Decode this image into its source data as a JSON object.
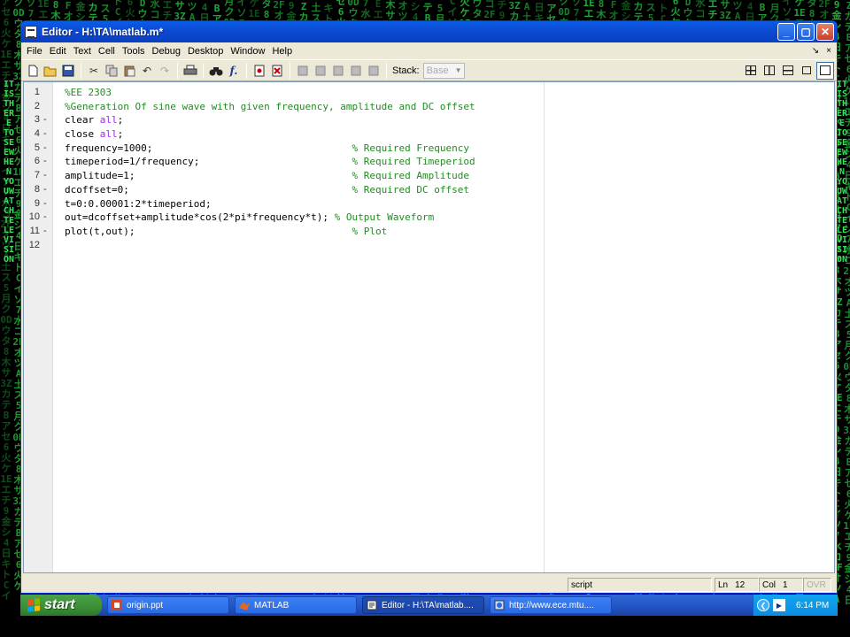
{
  "window": {
    "title": "Editor - H:\\TA\\matlab.m*",
    "controls": {
      "minimize": "_",
      "maximize": "▢",
      "close": "✕"
    }
  },
  "menu": {
    "items": [
      "File",
      "Edit",
      "Text",
      "Cell",
      "Tools",
      "Debug",
      "Desktop",
      "Window",
      "Help"
    ],
    "right_icons": [
      "↘",
      "×"
    ]
  },
  "toolbar": {
    "stack_label": "Stack:",
    "stack_value": "Base"
  },
  "editor": {
    "lines": [
      {
        "n": "1",
        "bp": "",
        "code": "",
        "comment": "%EE 2303"
      },
      {
        "n": "2",
        "bp": "",
        "code": "",
        "comment": "%Generation Of sine wave with given frequency, amplitude and DC offset"
      },
      {
        "n": "3",
        "bp": "-",
        "code": "clear ",
        "kw": "all",
        "tail": ";"
      },
      {
        "n": "4",
        "bp": "-",
        "code": "close ",
        "kw": "all",
        "tail": ";"
      },
      {
        "n": "5",
        "bp": "-",
        "code": "frequency=1000;                                  ",
        "comment": "% Required Frequency"
      },
      {
        "n": "6",
        "bp": "-",
        "code": "timeperiod=1/frequency;                          ",
        "comment": "% Required Timeperiod"
      },
      {
        "n": "7",
        "bp": "-",
        "code": "amplitude=1;                                     ",
        "comment": "% Required Amplitude"
      },
      {
        "n": "8",
        "bp": "-",
        "code": "dcoffset=0;                                      ",
        "comment": "% Required DC offset"
      },
      {
        "n": "9",
        "bp": "-",
        "code": "t=0:0.00001:2*timeperiod;",
        "comment": ""
      },
      {
        "n": "10",
        "bp": "-",
        "code": "out=dcoffset+amplitude*cos(2*pi*frequency*t); ",
        "comment": "% Output Waveform"
      },
      {
        "n": "11",
        "bp": "-",
        "code": "plot(t,out);                                     ",
        "comment": "% Plot"
      },
      {
        "n": "12",
        "bp": "",
        "code": "",
        "comment": ""
      }
    ]
  },
  "status": {
    "mode": "script",
    "ln_label": "Ln",
    "ln_value": "12",
    "col_label": "Col",
    "col_value": "1",
    "ovr": "OVR"
  },
  "taskbar": {
    "start_label": "start",
    "tasks": [
      "origin.ppt",
      "MATLAB",
      "Editor - H:\\TA\\matlab....",
      "http://www.ece.mtu...."
    ],
    "clock": "6:14 PM"
  },
  "colors": {
    "comment": "#228b22",
    "keyword": "#a020f0",
    "titlebar": "#0a4ad1",
    "matrix_green": "#2bd94a"
  }
}
